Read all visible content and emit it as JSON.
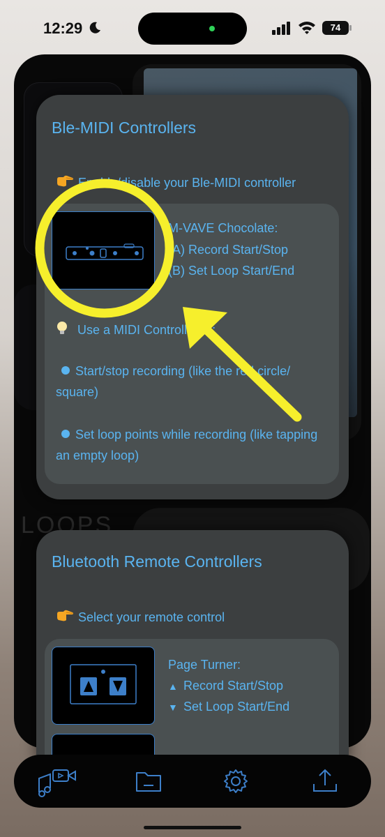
{
  "status_bar": {
    "time": "12:29",
    "battery": "74"
  },
  "background": {
    "loops_label": "LOOPS"
  },
  "ble_panel": {
    "title": "Ble-MIDI Controllers",
    "hint": "Enable/disable your Ble-MIDI controller",
    "controller": {
      "name": "M-VAVE Chocolate:",
      "line_a": "(A)  Record Start/Stop",
      "line_b": "(B)  Set Loop Start/End"
    },
    "tip": "Use a MIDI Controller to:",
    "bullets": [
      "Start/stop recording (like the red circle/ square)",
      "Set loop points while recording (like tapping an empty loop)"
    ]
  },
  "bluetooth_panel": {
    "title": "Bluetooth Remote Controllers",
    "hint": "Select your remote control",
    "controller": {
      "name": "Page Turner:",
      "line_a": "Record Start/Stop",
      "line_b": "Set Loop Start/End"
    }
  },
  "tabs": [
    {
      "icon": "music-video-icon",
      "label": ""
    },
    {
      "icon": "folder-icon",
      "label": ""
    },
    {
      "icon": "gear-icon",
      "label": ""
    },
    {
      "icon": "share-icon",
      "label": ""
    }
  ],
  "colors": {
    "accent": "#5ab4f0",
    "panel": "#3c3f40",
    "inner": "#4a5051",
    "highlight": "#f6ef2c"
  }
}
